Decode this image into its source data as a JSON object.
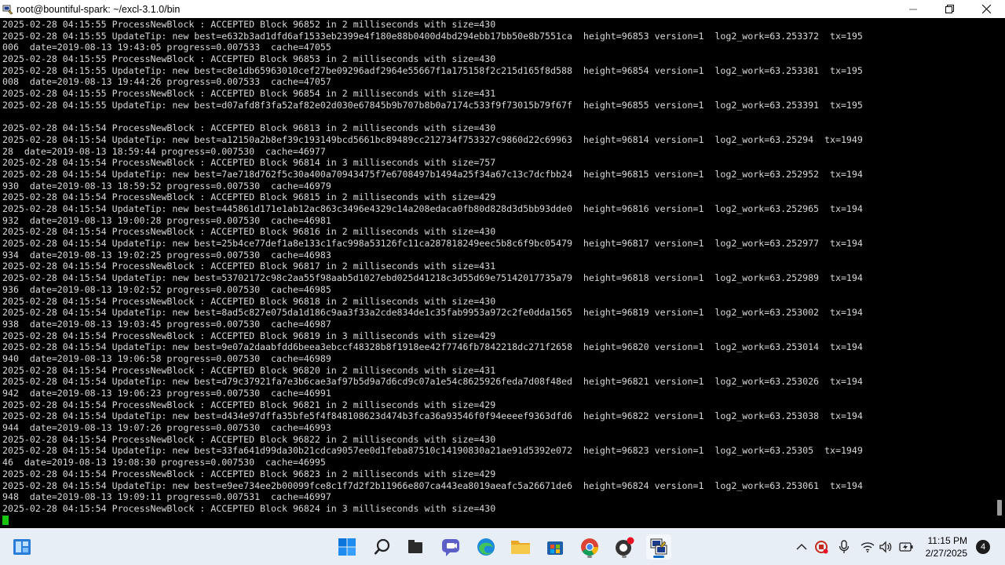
{
  "window": {
    "title": "root@bountiful-spark: ~/excl-3.1.0/bin",
    "icon": "terminal-app-icon",
    "controls": [
      "minimize-icon",
      "maximize-icon",
      "close-icon"
    ]
  },
  "terminal": {
    "lines": [
      "2025-02-28 04:15:55 ProcessNewBlock : ACCEPTED Block 96852 in 2 milliseconds with size=430",
      "2025-02-28 04:15:55 UpdateTip: new best=e632b3ad1dfd6af1533eb2399e4f180e88b0400d4bd294ebb17bb50e8b7551ca  height=96853 version=1  log2_work=63.253372  tx=195",
      "006  date=2019-08-13 19:43:05 progress=0.007533  cache=47055",
      "2025-02-28 04:15:55 ProcessNewBlock : ACCEPTED Block 96853 in 2 milliseconds with size=430",
      "2025-02-28 04:15:55 UpdateTip: new best=c8e1db65963010cef27be09296adf2964e55667f1a175158f2c215d165f8d588  height=96854 version=1  log2_work=63.253381  tx=195",
      "008  date=2019-08-13 19:44:26 progress=0.007533  cache=47057",
      "2025-02-28 04:15:55 ProcessNewBlock : ACCEPTED Block 96854 in 2 milliseconds with size=431",
      "2025-02-28 04:15:55 UpdateTip: new best=d07afd8f3fa52af82e02d030e67845b9b707b8b0a7174c533f9f73015b79f67f  height=96855 version=1  log2_work=63.253391  tx=195",
      "",
      "2025-02-28 04:15:54 ProcessNewBlock : ACCEPTED Block 96813 in 2 milliseconds with size=430",
      "2025-02-28 04:15:54 UpdateTip: new best=a12150a2b8ef39c193149bcd5661bc89489cc212734f753327c9860d22c69963  height=96814 version=1  log2_work=63.25294  tx=1949",
      "28  date=2019-08-13 18:59:44 progress=0.007530  cache=46977",
      "2025-02-28 04:15:54 ProcessNewBlock : ACCEPTED Block 96814 in 3 milliseconds with size=757",
      "2025-02-28 04:15:54 UpdateTip: new best=7ae718d762f5c30a400a70943475f7e6708497b1494a25f34a67c13c7dcfbb24  height=96815 version=1  log2_work=63.252952  tx=194",
      "930  date=2019-08-13 18:59:52 progress=0.007530  cache=46979",
      "2025-02-28 04:15:54 ProcessNewBlock : ACCEPTED Block 96815 in 2 milliseconds with size=429",
      "2025-02-28 04:15:54 UpdateTip: new best=445861d171e1ab12ac863c3496e4329c14a208edaca0fb80d828d3d5bb93dde0  height=96816 version=1  log2_work=63.252965  tx=194",
      "932  date=2019-08-13 19:00:28 progress=0.007530  cache=46981",
      "2025-02-28 04:15:54 ProcessNewBlock : ACCEPTED Block 96816 in 2 milliseconds with size=430",
      "2025-02-28 04:15:54 UpdateTip: new best=25b4ce77def1a8e133c1fac998a53126fc11ca287818249eec5b8c6f9bc05479  height=96817 version=1  log2_work=63.252977  tx=194",
      "934  date=2019-08-13 19:02:25 progress=0.007530  cache=46983",
      "2025-02-28 04:15:54 ProcessNewBlock : ACCEPTED Block 96817 in 2 milliseconds with size=431",
      "2025-02-28 04:15:54 UpdateTip: new best=53702172c98c2aa55f98aab5d1027ebd025d41218c3d55d69e75142017735a79  height=96818 version=1  log2_work=63.252989  tx=194",
      "936  date=2019-08-13 19:02:52 progress=0.007530  cache=46985",
      "2025-02-28 04:15:54 ProcessNewBlock : ACCEPTED Block 96818 in 2 milliseconds with size=430",
      "2025-02-28 04:15:54 UpdateTip: new best=8ad5c827e075da1d186c9aa3f33a2cde834de1c35fab9953a972c2fe0dda1565  height=96819 version=1  log2_work=63.253002  tx=194",
      "938  date=2019-08-13 19:03:45 progress=0.007530  cache=46987",
      "2025-02-28 04:15:54 ProcessNewBlock : ACCEPTED Block 96819 in 3 milliseconds with size=429",
      "2025-02-28 04:15:54 UpdateTip: new best=9e07a2daabfdd6beea3ebccf48328b8f1918ee42f7746fb7842218dc271f2658  height=96820 version=1  log2_work=63.253014  tx=194",
      "940  date=2019-08-13 19:06:58 progress=0.007530  cache=46989",
      "2025-02-28 04:15:54 ProcessNewBlock : ACCEPTED Block 96820 in 2 milliseconds with size=431",
      "2025-02-28 04:15:54 UpdateTip: new best=d79c37921fa7e3b6cae3af97b5d9a7d6cd9c07a1e54c8625926feda7d08f48ed  height=96821 version=1  log2_work=63.253026  tx=194",
      "942  date=2019-08-13 19:06:23 progress=0.007530  cache=46991",
      "2025-02-28 04:15:54 ProcessNewBlock : ACCEPTED Block 96821 in 2 milliseconds with size=429",
      "2025-02-28 04:15:54 UpdateTip: new best=d434e97dffa35bfe5f4f848108623d474b3fca36a93546f0f94eeeef9363dfd6  height=96822 version=1  log2_work=63.253038  tx=194",
      "944  date=2019-08-13 19:07:26 progress=0.007530  cache=46993",
      "2025-02-28 04:15:54 ProcessNewBlock : ACCEPTED Block 96822 in 2 milliseconds with size=430",
      "2025-02-28 04:15:54 UpdateTip: new best=33fa641d99da30b21cdca9057ee0d1feba87510c14190830a21ae91d5392e072  height=96823 version=1  log2_work=63.25305  tx=1949",
      "46  date=2019-08-13 19:08:30 progress=0.007530  cache=46995",
      "2025-02-28 04:15:54 ProcessNewBlock : ACCEPTED Block 96823 in 2 milliseconds with size=429",
      "2025-02-28 04:15:54 UpdateTip: new best=e9ee734ee2b00099fce8c1f7d2f2b11966e807ca443ea8019aeafc5a26671de6  height=96824 version=1  log2_work=63.253061  tx=194",
      "948  date=2019-08-13 19:09:11 progress=0.007531  cache=46997",
      "2025-02-28 04:15:54 ProcessNewBlock : ACCEPTED Block 96824 in 3 milliseconds with size=430"
    ],
    "cursor_color": "#16c60c",
    "background": "#000000",
    "foreground": "#d8d8d8"
  },
  "taskbar": {
    "apps": [
      {
        "name": "widgets",
        "icon": "widgets-icon",
        "running": false
      },
      {
        "name": "start",
        "icon": "windows-start-icon",
        "running": false
      },
      {
        "name": "search",
        "icon": "search-icon",
        "running": false
      },
      {
        "name": "file-explorer-dark",
        "icon": "task-view-icon",
        "running": false
      },
      {
        "name": "teams",
        "icon": "teams-chat-icon",
        "running": false
      },
      {
        "name": "edge",
        "icon": "edge-browser-icon",
        "running": false
      },
      {
        "name": "file-explorer",
        "icon": "folder-icon",
        "running": false
      },
      {
        "name": "store",
        "icon": "store-icon",
        "running": false
      },
      {
        "name": "chrome",
        "icon": "chrome-icon",
        "running": true
      },
      {
        "name": "github-desktop",
        "icon": "github-icon",
        "running": true
      },
      {
        "name": "putty",
        "icon": "putty-icon",
        "running": true,
        "active": true
      }
    ],
    "tray": {
      "icons": [
        "chevron-up-icon",
        "app-tray-icon",
        "microphone-icon",
        "wifi-icon",
        "volume-icon",
        "battery-icon"
      ],
      "time": "11:15 PM",
      "date": "2/27/2025",
      "notifications": "4"
    }
  }
}
